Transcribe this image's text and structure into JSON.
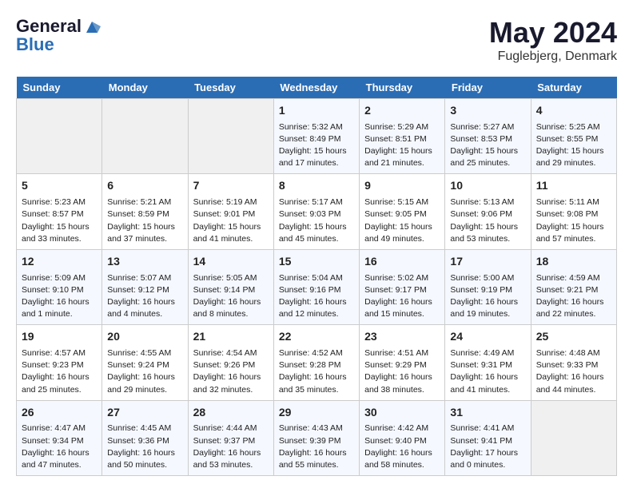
{
  "header": {
    "logo_line1": "General",
    "logo_line2": "Blue",
    "month_title": "May 2024",
    "location": "Fuglebjerg, Denmark"
  },
  "days_of_week": [
    "Sunday",
    "Monday",
    "Tuesday",
    "Wednesday",
    "Thursday",
    "Friday",
    "Saturday"
  ],
  "weeks": [
    [
      {
        "day": "",
        "info": ""
      },
      {
        "day": "",
        "info": ""
      },
      {
        "day": "",
        "info": ""
      },
      {
        "day": "1",
        "info": "Sunrise: 5:32 AM\nSunset: 8:49 PM\nDaylight: 15 hours\nand 17 minutes."
      },
      {
        "day": "2",
        "info": "Sunrise: 5:29 AM\nSunset: 8:51 PM\nDaylight: 15 hours\nand 21 minutes."
      },
      {
        "day": "3",
        "info": "Sunrise: 5:27 AM\nSunset: 8:53 PM\nDaylight: 15 hours\nand 25 minutes."
      },
      {
        "day": "4",
        "info": "Sunrise: 5:25 AM\nSunset: 8:55 PM\nDaylight: 15 hours\nand 29 minutes."
      }
    ],
    [
      {
        "day": "5",
        "info": "Sunrise: 5:23 AM\nSunset: 8:57 PM\nDaylight: 15 hours\nand 33 minutes."
      },
      {
        "day": "6",
        "info": "Sunrise: 5:21 AM\nSunset: 8:59 PM\nDaylight: 15 hours\nand 37 minutes."
      },
      {
        "day": "7",
        "info": "Sunrise: 5:19 AM\nSunset: 9:01 PM\nDaylight: 15 hours\nand 41 minutes."
      },
      {
        "day": "8",
        "info": "Sunrise: 5:17 AM\nSunset: 9:03 PM\nDaylight: 15 hours\nand 45 minutes."
      },
      {
        "day": "9",
        "info": "Sunrise: 5:15 AM\nSunset: 9:05 PM\nDaylight: 15 hours\nand 49 minutes."
      },
      {
        "day": "10",
        "info": "Sunrise: 5:13 AM\nSunset: 9:06 PM\nDaylight: 15 hours\nand 53 minutes."
      },
      {
        "day": "11",
        "info": "Sunrise: 5:11 AM\nSunset: 9:08 PM\nDaylight: 15 hours\nand 57 minutes."
      }
    ],
    [
      {
        "day": "12",
        "info": "Sunrise: 5:09 AM\nSunset: 9:10 PM\nDaylight: 16 hours\nand 1 minute."
      },
      {
        "day": "13",
        "info": "Sunrise: 5:07 AM\nSunset: 9:12 PM\nDaylight: 16 hours\nand 4 minutes."
      },
      {
        "day": "14",
        "info": "Sunrise: 5:05 AM\nSunset: 9:14 PM\nDaylight: 16 hours\nand 8 minutes."
      },
      {
        "day": "15",
        "info": "Sunrise: 5:04 AM\nSunset: 9:16 PM\nDaylight: 16 hours\nand 12 minutes."
      },
      {
        "day": "16",
        "info": "Sunrise: 5:02 AM\nSunset: 9:17 PM\nDaylight: 16 hours\nand 15 minutes."
      },
      {
        "day": "17",
        "info": "Sunrise: 5:00 AM\nSunset: 9:19 PM\nDaylight: 16 hours\nand 19 minutes."
      },
      {
        "day": "18",
        "info": "Sunrise: 4:59 AM\nSunset: 9:21 PM\nDaylight: 16 hours\nand 22 minutes."
      }
    ],
    [
      {
        "day": "19",
        "info": "Sunrise: 4:57 AM\nSunset: 9:23 PM\nDaylight: 16 hours\nand 25 minutes."
      },
      {
        "day": "20",
        "info": "Sunrise: 4:55 AM\nSunset: 9:24 PM\nDaylight: 16 hours\nand 29 minutes."
      },
      {
        "day": "21",
        "info": "Sunrise: 4:54 AM\nSunset: 9:26 PM\nDaylight: 16 hours\nand 32 minutes."
      },
      {
        "day": "22",
        "info": "Sunrise: 4:52 AM\nSunset: 9:28 PM\nDaylight: 16 hours\nand 35 minutes."
      },
      {
        "day": "23",
        "info": "Sunrise: 4:51 AM\nSunset: 9:29 PM\nDaylight: 16 hours\nand 38 minutes."
      },
      {
        "day": "24",
        "info": "Sunrise: 4:49 AM\nSunset: 9:31 PM\nDaylight: 16 hours\nand 41 minutes."
      },
      {
        "day": "25",
        "info": "Sunrise: 4:48 AM\nSunset: 9:33 PM\nDaylight: 16 hours\nand 44 minutes."
      }
    ],
    [
      {
        "day": "26",
        "info": "Sunrise: 4:47 AM\nSunset: 9:34 PM\nDaylight: 16 hours\nand 47 minutes."
      },
      {
        "day": "27",
        "info": "Sunrise: 4:45 AM\nSunset: 9:36 PM\nDaylight: 16 hours\nand 50 minutes."
      },
      {
        "day": "28",
        "info": "Sunrise: 4:44 AM\nSunset: 9:37 PM\nDaylight: 16 hours\nand 53 minutes."
      },
      {
        "day": "29",
        "info": "Sunrise: 4:43 AM\nSunset: 9:39 PM\nDaylight: 16 hours\nand 55 minutes."
      },
      {
        "day": "30",
        "info": "Sunrise: 4:42 AM\nSunset: 9:40 PM\nDaylight: 16 hours\nand 58 minutes."
      },
      {
        "day": "31",
        "info": "Sunrise: 4:41 AM\nSunset: 9:41 PM\nDaylight: 17 hours\nand 0 minutes."
      },
      {
        "day": "",
        "info": ""
      }
    ]
  ]
}
